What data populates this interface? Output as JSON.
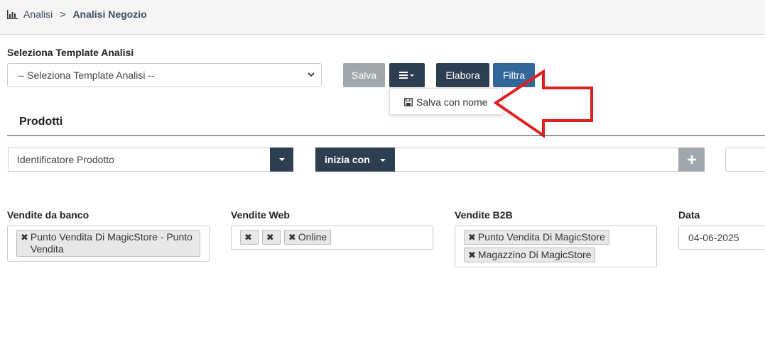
{
  "breadcrumb": {
    "icon": "bar-chart-icon",
    "parent": "Analisi",
    "separator": ">",
    "current": "Analisi Negozio"
  },
  "template": {
    "label": "Seleziona Template Analisi",
    "selected": "-- Seleziona Template Analisi --"
  },
  "toolbar": {
    "salva": "Salva",
    "menu_icon": "hamburger-icon",
    "elabora": "Elabora",
    "filtra": "Filtra"
  },
  "menu": {
    "save_as_icon": "floppy-disk-icon",
    "save_as": "Salva con nome"
  },
  "annotation": {
    "color": "#e02020",
    "icon": "arrow-left-outline"
  },
  "products": {
    "title": "Prodotti",
    "field": "Identificatore Prodotto",
    "condition": "inizia con",
    "value": "",
    "add_icon": "plus-icon"
  },
  "filters": {
    "banco": {
      "label": "Vendite da banco",
      "tags": [
        "Punto Vendita Di MagicStore - Punto Vendita"
      ]
    },
    "web": {
      "label": "Vendite Web",
      "tags": [
        "",
        "",
        "Online"
      ]
    },
    "b2b": {
      "label": "Vendite B2B",
      "tags": [
        "Punto Vendita Di MagicStore",
        "Magazzino Di MagicStore"
      ]
    },
    "data": {
      "label": "Data",
      "value": "04-06-2025"
    }
  },
  "colors": {
    "dark": "#2c3e50",
    "blue": "#336699",
    "disabled": "#a0a8ae",
    "topbar": "#f5f5f5"
  }
}
